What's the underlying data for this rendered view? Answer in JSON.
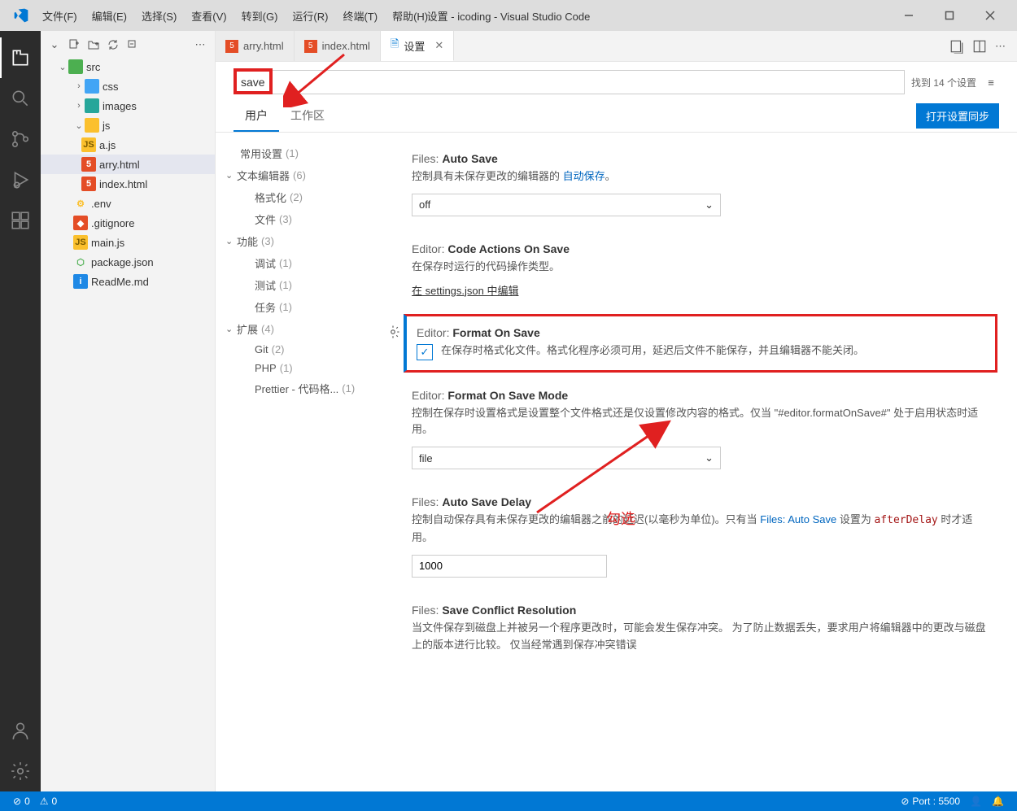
{
  "window": {
    "title": "设置 - icoding - Visual Studio Code",
    "menu": [
      "文件(F)",
      "编辑(E)",
      "选择(S)",
      "查看(V)",
      "转到(G)",
      "运行(R)",
      "终端(T)",
      "帮助(H)"
    ]
  },
  "explorer": {
    "tree": {
      "src": "src",
      "css": "css",
      "images": "images",
      "js": "js",
      "ajs": "a.js",
      "arry": "arry.html",
      "index": "index.html",
      "env": ".env",
      "gitignore": ".gitignore",
      "mainjs": "main.js",
      "pkg": "package.json",
      "readme": "ReadMe.md"
    }
  },
  "tabs": {
    "t1": "arry.html",
    "t2": "index.html",
    "t3": "设置"
  },
  "settings": {
    "search_value": "save",
    "result_count": "找到 14 个设置",
    "scope_user": "用户",
    "scope_ws": "工作区",
    "sync_btn": "打开设置同步",
    "toc": {
      "common": "常用设置",
      "common_n": "(1)",
      "textedit": "文本编辑器",
      "textedit_n": "(6)",
      "format": "格式化",
      "format_n": "(2)",
      "files": "文件",
      "files_n": "(3)",
      "features": "功能",
      "features_n": "(3)",
      "debug": "调试",
      "debug_n": "(1)",
      "test": "测试",
      "test_n": "(1)",
      "task": "任务",
      "task_n": "(1)",
      "ext": "扩展",
      "ext_n": "(4)",
      "git": "Git",
      "git_n": "(2)",
      "php": "PHP",
      "php_n": "(1)",
      "prettier": "Prettier - 代码格...",
      "prettier_n": "(1)"
    },
    "items": {
      "autosave": {
        "scope": "Files: ",
        "name": "Auto Save",
        "desc_pre": "控制具有未保存更改的编辑器的 ",
        "desc_link": "自动保存",
        "desc_post": "。",
        "value": "off"
      },
      "codeactions": {
        "scope": "Editor: ",
        "name": "Code Actions On Save",
        "desc": "在保存时运行的代码操作类型。",
        "link": "在 settings.json 中编辑"
      },
      "formatonsave": {
        "scope": "Editor: ",
        "name": "Format On Save",
        "desc": "在保存时格式化文件。格式化程序必须可用，延迟后文件不能保存，并且编辑器不能关闭。"
      },
      "formatmode": {
        "scope": "Editor: ",
        "name": "Format On Save Mode",
        "desc": "控制在保存时设置格式是设置整个文件格式还是仅设置修改内容的格式。仅当 \"#editor.formatOnSave#\" 处于启用状态时适用。",
        "value": "file"
      },
      "autosavedelay": {
        "scope": "Files: ",
        "name": "Auto Save Delay",
        "desc_pre": "控制自动保存具有未保存更改的编辑器之前的延迟(以毫秒为单位)。只有当 ",
        "desc_link": "Files: Auto Save",
        "desc_mid": " 设置为 ",
        "desc_code": "afterDelay",
        "desc_post": " 时才适用。",
        "value": "1000"
      },
      "conflict": {
        "scope": "Files: ",
        "name": "Save Conflict Resolution",
        "desc": "当文件保存到磁盘上并被另一个程序更改时，可能会发生保存冲突。 为了防止数据丢失，要求用户将编辑器中的更改与磁盘上的版本进行比较。 仅当经常遇到保存冲突错误"
      }
    }
  },
  "annotation": {
    "check_label": "勾选"
  },
  "status": {
    "errors": "0",
    "warnings": "0",
    "port": "Port : 5500"
  }
}
